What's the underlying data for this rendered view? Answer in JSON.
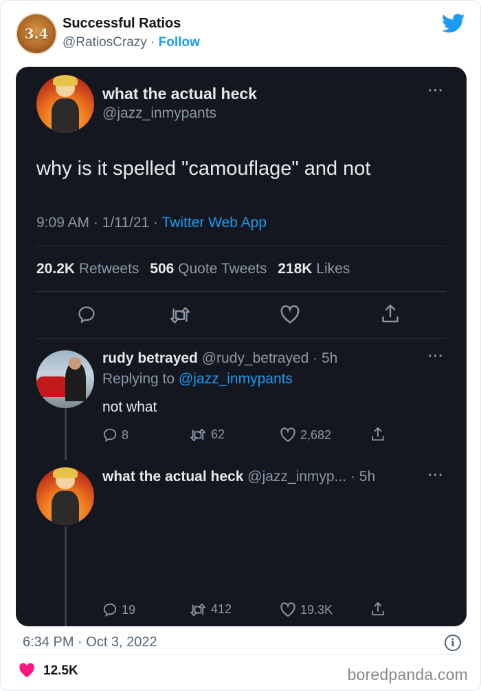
{
  "header": {
    "avatar_text": "3.4",
    "name": "Successful Ratios",
    "handle": "@RatiosCrazy",
    "separator": "·",
    "follow_label": "Follow",
    "bird_icon": "twitter-bird-icon",
    "bird_color": "#1d9bf0"
  },
  "screenshot": {
    "main_tweet": {
      "name": "what the actual heck",
      "handle": "@jazz_inmypants",
      "more": "···",
      "text": "why is it spelled \"camouflage\" and not",
      "time": "9:09 AM · 1/11/21 ·",
      "source": "Twitter Web App",
      "retweets_count": "20.2K",
      "retweets_label": "Retweets",
      "quotes_count": "506",
      "quotes_label": "Quote Tweets",
      "likes_count": "218K",
      "likes_label": "Likes"
    },
    "reply1": {
      "name": "rudy betrayed",
      "handle_time": "@rudy_betrayed · 5h",
      "replying_label": "Replying to",
      "replying_to": "@jazz_inmypants",
      "text": "not what",
      "more": "···",
      "replies": "8",
      "retweets": "62",
      "likes": "2,682"
    },
    "reply2": {
      "name": "what the actual heck",
      "handle_time": "@jazz_inmyp... · 5h",
      "more": "···",
      "replies": "19",
      "retweets": "412",
      "likes": "19.3K"
    }
  },
  "footer": {
    "timestamp": "6:34 PM · Oct 3, 2022",
    "info_label": "i",
    "likes": "12.5K",
    "like_color": "#f91880",
    "watermark": "boredpanda.com"
  }
}
